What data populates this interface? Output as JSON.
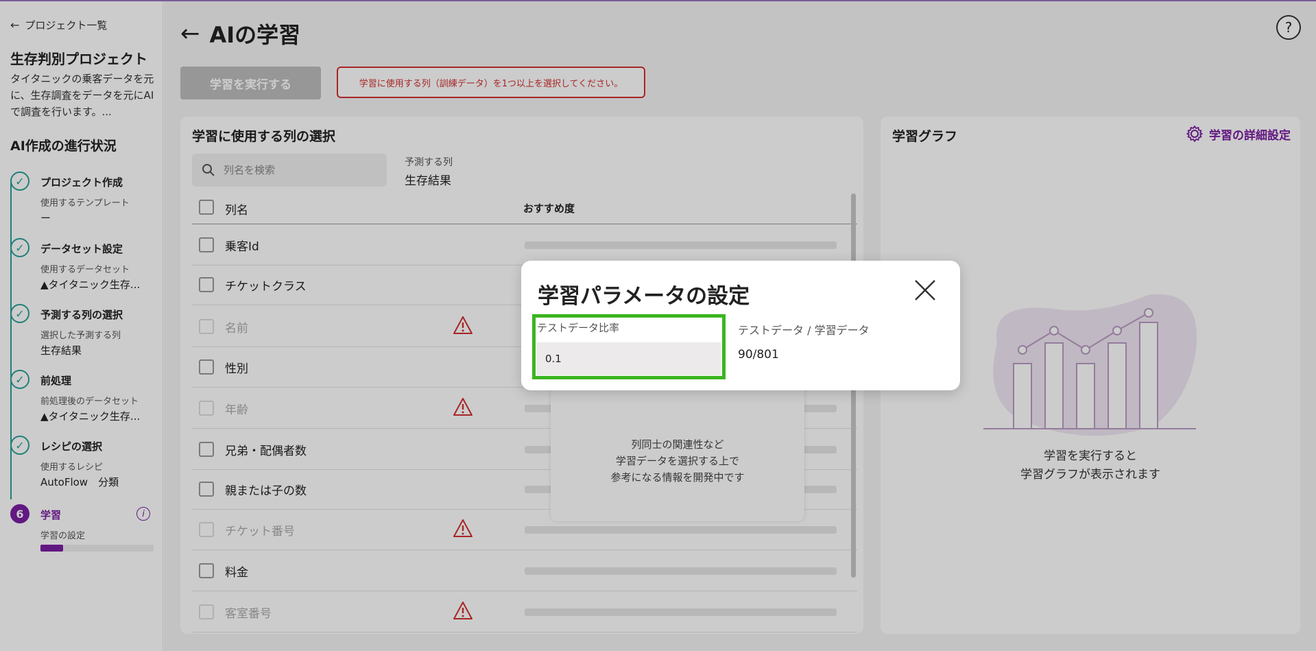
{
  "sidebar": {
    "back_label": "プロジェクト一覧",
    "project_title": "生存判別プロジェクト",
    "project_desc": "タイタニックの乗客データを元に、生存調査をデータを元にAIで調査を行います。...",
    "progress_title": "AI作成の進行状況",
    "steps": [
      {
        "title": "プロジェクト作成",
        "sub": "使用するテンプレート",
        "value": "ー"
      },
      {
        "title": "データセット設定",
        "sub": "使用するデータセット",
        "value": "▲タイタニック生存..."
      },
      {
        "title": "予測する列の選択",
        "sub": "選択した予測する列",
        "value": "生存結果"
      },
      {
        "title": "前処理",
        "sub": "前処理後のデータセット",
        "value": "▲タイタニック生存..."
      },
      {
        "title": "レシピの選択",
        "sub": "使用するレシピ",
        "value": "AutoFlow　分類"
      },
      {
        "number": "6",
        "title": "学習",
        "sub": "学習の設定",
        "progress": 0.2
      }
    ]
  },
  "main": {
    "title": "AIの学習",
    "run_button": "学習を実行する",
    "error_message": "学習に使用する列（訓練データ）を1つ以上を選択してください。",
    "left_card": {
      "title": "学習に使用する列の選択",
      "search_placeholder": "列名を検索",
      "pred_label": "予測する列",
      "pred_value": "生存結果",
      "col_header_name": "列名",
      "col_header_rec": "おすすめ度",
      "rows": [
        {
          "name": "乗客Id",
          "disabled": false,
          "warning": false
        },
        {
          "name": "チケットクラス",
          "disabled": false,
          "warning": false
        },
        {
          "name": "名前",
          "disabled": true,
          "warning": true
        },
        {
          "name": "性別",
          "disabled": false,
          "warning": false
        },
        {
          "name": "年齢",
          "disabled": true,
          "warning": true
        },
        {
          "name": "兄弟・配偶者数",
          "disabled": false,
          "warning": false
        },
        {
          "name": "親または子の数",
          "disabled": false,
          "warning": false
        },
        {
          "name": "チケット番号",
          "disabled": true,
          "warning": true
        },
        {
          "name": "料金",
          "disabled": false,
          "warning": false
        },
        {
          "name": "客室番号",
          "disabled": true,
          "warning": true
        }
      ],
      "dev_line1": "列同士の関連性など",
      "dev_line2": "学習データを選択する上で",
      "dev_line3": "参考になる情報を開発中です"
    },
    "right_card": {
      "title": "学習グラフ",
      "settings_link": "学習の詳細設定",
      "empty_line1": "学習を実行すると",
      "empty_line2": "学習グラフが表示されます"
    }
  },
  "modal": {
    "title": "学習パラメータの設定",
    "field_label": "テストデータ比率",
    "field_value": "0.1",
    "ratio_label": "テストデータ / 学習データ",
    "ratio_value": "90/801"
  },
  "colors": {
    "accent": "#7b1fa2",
    "teal": "#2aa198",
    "error": "#d32f2f",
    "highlight": "#3cb521"
  }
}
